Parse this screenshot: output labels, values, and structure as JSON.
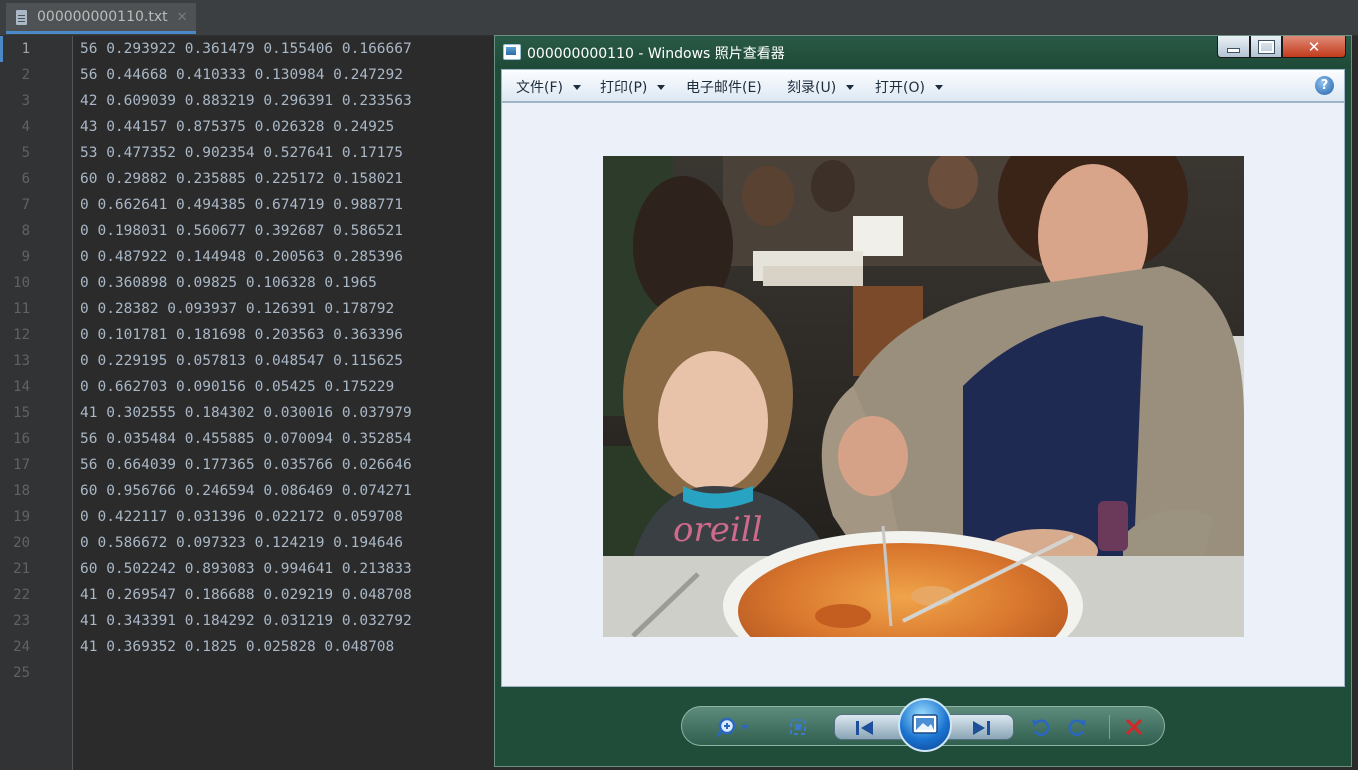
{
  "editor": {
    "tab": {
      "filename": "000000000110.txt",
      "close": "✕"
    },
    "lines": [
      "56 0.293922 0.361479 0.155406 0.166667",
      "56 0.44668 0.410333 0.130984 0.247292",
      "42 0.609039 0.883219 0.296391 0.233563",
      "43 0.44157 0.875375 0.026328 0.24925",
      "53 0.477352 0.902354 0.527641 0.17175",
      "60 0.29882 0.235885 0.225172 0.158021",
      "0 0.662641 0.494385 0.674719 0.988771",
      "0 0.198031 0.560677 0.392687 0.586521",
      "0 0.487922 0.144948 0.200563 0.285396",
      "0 0.360898 0.09825 0.106328 0.1965",
      "0 0.28382 0.093937 0.126391 0.178792",
      "0 0.101781 0.181698 0.203563 0.363396",
      "0 0.229195 0.057813 0.048547 0.115625",
      "0 0.662703 0.090156 0.05425 0.175229",
      "41 0.302555 0.184302 0.030016 0.037979",
      "56 0.035484 0.455885 0.070094 0.352854",
      "56 0.664039 0.177365 0.035766 0.026646",
      "60 0.956766 0.246594 0.086469 0.074271",
      "0 0.422117 0.031396 0.022172 0.059708",
      "0 0.586672 0.097323 0.124219 0.194646",
      "60 0.502242 0.893083 0.994641 0.213833",
      "41 0.269547 0.186688 0.029219 0.048708",
      "41 0.343391 0.184292 0.031219 0.032792",
      "41 0.369352 0.1825 0.025828 0.048708",
      ""
    ]
  },
  "viewer": {
    "title": "000000000110 - Windows 照片查看器",
    "menu": [
      {
        "label": "文件(F)",
        "dropdown": true
      },
      {
        "label": "打印(P)",
        "dropdown": true
      },
      {
        "label": "电子邮件(E)",
        "dropdown": false
      },
      {
        "label": "刻录(U)",
        "dropdown": true
      },
      {
        "label": "打开(O)",
        "dropdown": true
      }
    ],
    "help": "?",
    "toolbar_icons": [
      "zoom-icon",
      "actual-size-icon",
      "previous-icon",
      "slideshow-icon",
      "next-icon",
      "rotate-left-icon",
      "rotate-right-icon",
      "delete-icon"
    ]
  }
}
